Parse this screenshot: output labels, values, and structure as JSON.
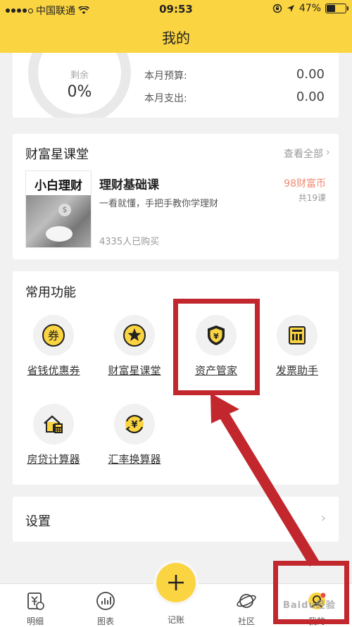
{
  "status_bar": {
    "carrier": "中国联通",
    "time": "09:53",
    "battery_text": "47%",
    "battery_level": 0.47
  },
  "header": {
    "title": "我的"
  },
  "summary": {
    "ring_label": "剩余",
    "ring_value": "0%",
    "rows": [
      {
        "label": "本月预算:",
        "value": "0.00"
      },
      {
        "label": "本月支出:",
        "value": "0.00"
      }
    ]
  },
  "course": {
    "header": "财富星课堂",
    "see_all": "查看全部",
    "thumb_title": "小白理财",
    "title": "理财基础课",
    "desc": "一看就懂，手把手教你学理财",
    "buyers": "4335人已购买",
    "price": "98财富币",
    "lessons": "共19课"
  },
  "functions": {
    "header": "常用功能",
    "items": [
      {
        "label": "省钱优惠券",
        "icon": "coupon-icon"
      },
      {
        "label": "财富星课堂",
        "icon": "star-icon"
      },
      {
        "label": "资产管家",
        "icon": "shield-yen-icon"
      },
      {
        "label": "发票助手",
        "icon": "invoice-icon"
      },
      {
        "label": "房贷计算器",
        "icon": "house-calculator-icon"
      },
      {
        "label": "汇率换算器",
        "icon": "exchange-yen-icon"
      }
    ]
  },
  "settings": {
    "label": "设置"
  },
  "tabs": [
    {
      "label": "明细",
      "icon": "detail-icon"
    },
    {
      "label": "图表",
      "icon": "chart-icon"
    },
    {
      "label": "记账",
      "icon": "plus-icon"
    },
    {
      "label": "社区",
      "icon": "planet-icon"
    },
    {
      "label": "我的",
      "icon": "profile-icon"
    }
  ],
  "watermark": "Baidu经验",
  "colors": {
    "brand": "#fbd441",
    "highlight": "#c1272d",
    "price": "#f08a72"
  }
}
